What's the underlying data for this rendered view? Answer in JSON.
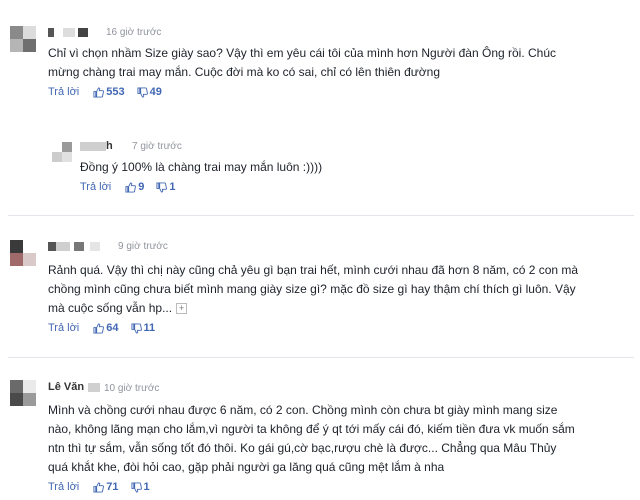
{
  "comments": [
    {
      "time": "16 giờ trước",
      "text": "Chỉ vì chọn nhầm Size giày sao? Vậy thì em yêu cái tôi của mình hơn Người đàn Ông rồi. Chúc\nmừng chàng trai may mắn. Cuộc đời mà ko có sai, chỉ có lên thiên đường",
      "reply_label": "Trả lời",
      "likes": "553",
      "dislikes": "49"
    },
    {
      "name_visible": "h",
      "time": "7 giờ trước",
      "text": "Đồng ý 100% là chàng trai may mắn luôn :))))",
      "reply_label": "Trả lời",
      "likes": "9",
      "dislikes": "1"
    },
    {
      "time": "9 giờ trước",
      "text": "Rảnh quá. Vậy thì chị này cũng chả yêu gì bạn trai hết, mình cưới nhau đã hơn 8 năm, có 2 con mà\nchồng mình cũng chưa biết mình mang giày size gì? mặc đồ size gì hay thậm chí thích gì luôn. Vậy\nmà cuộc sống vẫn hp...",
      "more_label": "+",
      "reply_label": "Trả lời",
      "likes": "64",
      "dislikes": "11"
    },
    {
      "name_visible": "Lê Văn",
      "time": "10 giờ trước",
      "text": "Mình và chồng cưới nhau được 6 năm, có 2 con. Chồng mình còn chưa bt giày mình mang size\nnào, không lãng mạn cho lắm,vì người ta không để ý qt tới mấy cái đó, kiếm tiền đưa vk muốn sắm\nntn thì tự sắm, vẫn sống tốt đó thôi. Ko gái gú,cờ bạc,rượu chè là được... Chẳng qua Mâu Thủy\nquá khắt khe, đòi hỏi cao, gặp phải người ga lăng quá cũng mệt lắm à nha",
      "reply_label": "Trả lời",
      "likes": "71",
      "dislikes": "1"
    }
  ],
  "colors": {
    "link": "#4267b2",
    "meta": "#90949c",
    "text": "#1d2129",
    "divider": "#e4e6eb"
  },
  "icons": {
    "like": "thumbs-up-icon",
    "dislike": "thumbs-down-icon"
  }
}
